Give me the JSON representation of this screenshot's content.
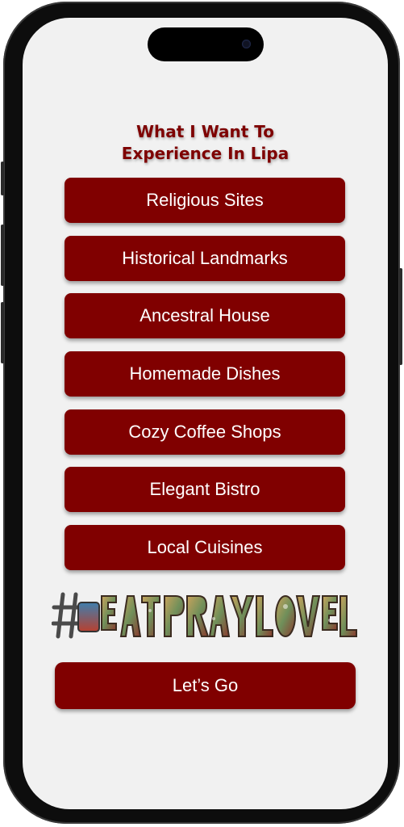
{
  "page": {
    "title": "What I Want To\nExperience In Lipa"
  },
  "options": [
    {
      "label": "Religious Sites"
    },
    {
      "label": "Historical Landmarks"
    },
    {
      "label": "Ancestral House"
    },
    {
      "label": "Homemade Dishes"
    },
    {
      "label": "Cozy Coffee Shops"
    },
    {
      "label": "Elegant Bistro"
    },
    {
      "label": "Local Cuisines"
    }
  ],
  "logo": {
    "text": "#EatPrayLoveLipa"
  },
  "primary_action": {
    "label": "Let’s Go"
  },
  "colors": {
    "accent": "#800000",
    "title": "#7e0000",
    "screen_bg": "#f1f1f1",
    "button_text": "#ffffff"
  },
  "icons": [
    "camera-icon",
    "hashtag-logo-icon"
  ]
}
